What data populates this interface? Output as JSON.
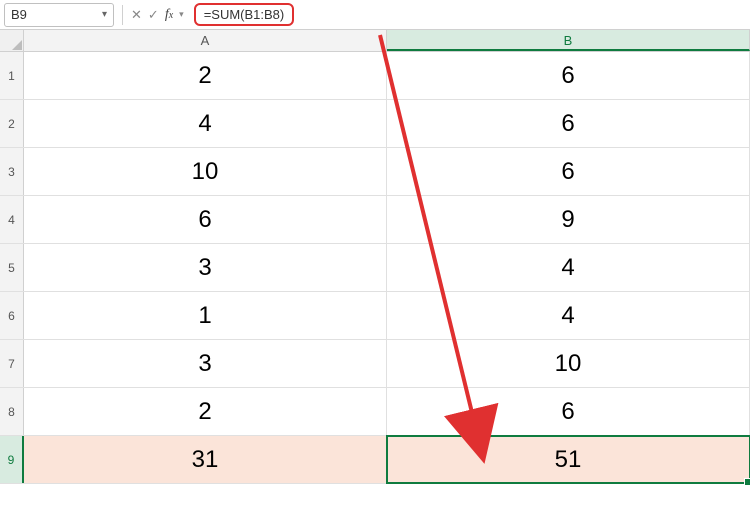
{
  "namebox": {
    "value": "B9"
  },
  "formula": {
    "text": "=SUM(B1:B8)"
  },
  "columns": [
    "A",
    "B"
  ],
  "rows": [
    "1",
    "2",
    "3",
    "4",
    "5",
    "6",
    "7",
    "8",
    "9"
  ],
  "chart_data": {
    "type": "table",
    "columns": [
      "A",
      "B"
    ],
    "data": {
      "A": [
        2,
        4,
        10,
        6,
        3,
        1,
        3,
        2,
        31
      ],
      "B": [
        6,
        6,
        6,
        9,
        4,
        4,
        10,
        6,
        51
      ]
    },
    "sum_row_index": 8,
    "selected_cell": "B9"
  }
}
